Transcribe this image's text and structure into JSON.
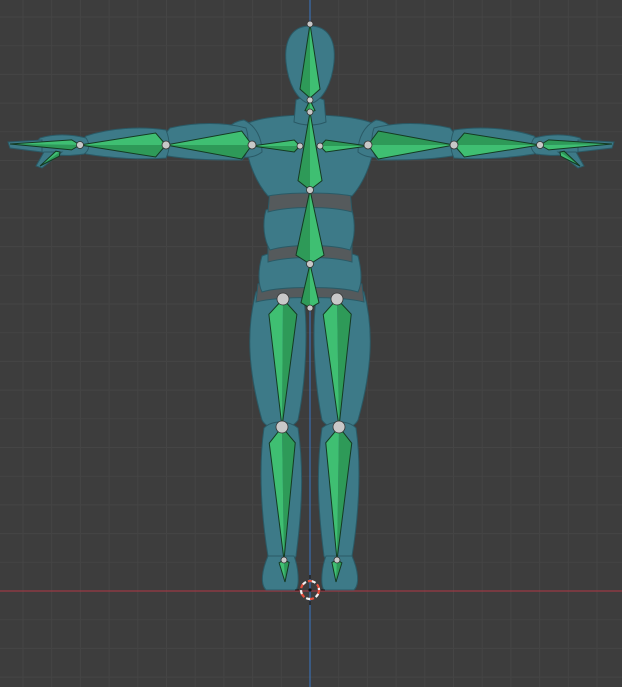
{
  "viewport": {
    "view": "front-orthographic",
    "background_color": "#3d3d3d",
    "grid_minor_color": "#454545",
    "grid_major_color": "#4a4a4a",
    "x_axis_color": "#9a3a44",
    "z_axis_color": "#3a6fb0"
  },
  "scene": {
    "mesh": {
      "name": "character-mesh",
      "pose": "T-pose",
      "color": "#3d7a88",
      "shadow_color": "#2f5f6a",
      "edge_color": "#2a5a66",
      "belt_color": "#555a5c"
    },
    "armature": {
      "name": "armature",
      "display": "octahedral",
      "bone_fill": "#3fbf72",
      "bone_fill_dark": "#2e9a58",
      "bone_stroke": "#143a22",
      "joint_color": "#c8c8c8"
    },
    "cursor": {
      "name": "3d-cursor",
      "ring_color": "#e8503c",
      "ring_alt_color": "#f2f2f2"
    }
  }
}
